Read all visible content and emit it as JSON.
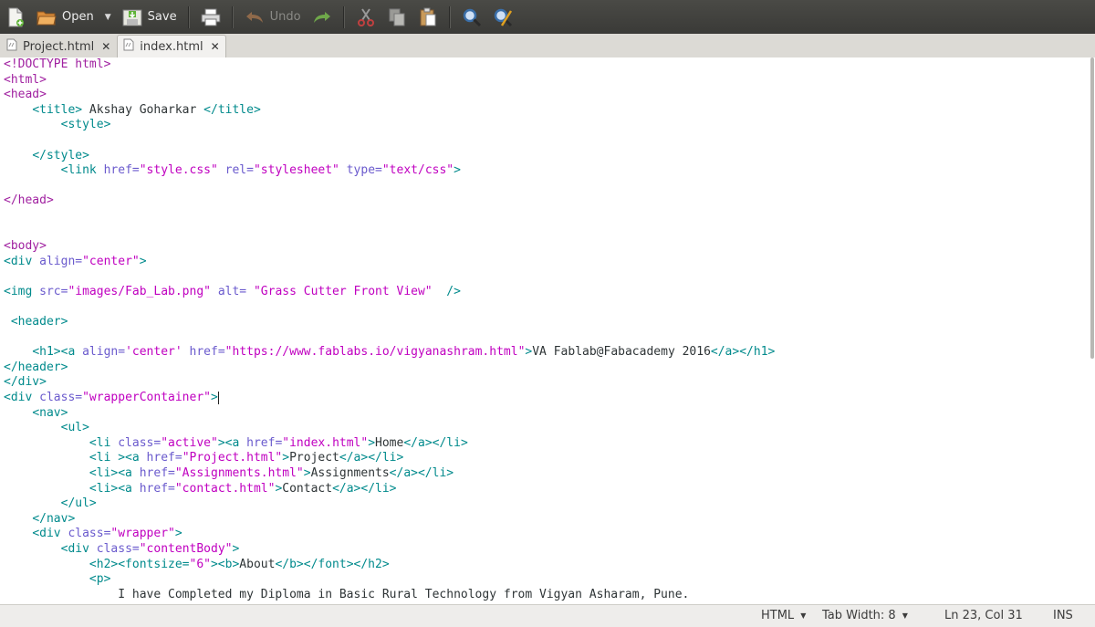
{
  "toolbar": {
    "buttons": [
      {
        "icon": "new-document-icon",
        "label": ""
      },
      {
        "icon": "open-folder-icon",
        "label": "Open"
      },
      {
        "icon": "save-icon",
        "label": "Save"
      },
      {
        "icon": "print-icon",
        "label": ""
      },
      {
        "icon": "undo-icon",
        "label": "Undo"
      },
      {
        "icon": "redo-icon",
        "label": ""
      },
      {
        "icon": "cut-icon",
        "label": ""
      },
      {
        "icon": "copy-icon",
        "label": ""
      },
      {
        "icon": "paste-icon",
        "label": ""
      },
      {
        "icon": "search-icon",
        "label": ""
      },
      {
        "icon": "replace-icon",
        "label": ""
      }
    ],
    "open_label": "Open",
    "save_label": "Save",
    "undo_label": "Undo"
  },
  "tabs": [
    {
      "label": "Project.html",
      "active": false
    },
    {
      "label": "index.html",
      "active": true
    }
  ],
  "editor": {
    "lines": [
      [
        [
          "tag",
          "<!DOCTYPE html>"
        ]
      ],
      [
        [
          "tag",
          "<html>"
        ]
      ],
      [
        [
          "tag",
          "<head>"
        ]
      ],
      [
        [
          "text",
          "    "
        ],
        [
          "tagname",
          "<title>"
        ],
        [
          "text",
          " Akshay Goharkar "
        ],
        [
          "tagname",
          "</title>"
        ]
      ],
      [
        [
          "text",
          "        "
        ],
        [
          "tagname",
          "<style>"
        ]
      ],
      [],
      [
        [
          "text",
          "    "
        ],
        [
          "tagname",
          "</style>"
        ]
      ],
      [
        [
          "text",
          "        "
        ],
        [
          "tagname",
          "<link "
        ],
        [
          "attr",
          "href="
        ],
        [
          "str",
          "\"style.css\""
        ],
        [
          "attr",
          " rel="
        ],
        [
          "str",
          "\"stylesheet\""
        ],
        [
          "attr",
          " type="
        ],
        [
          "str",
          "\"text/css\""
        ],
        [
          "tagname",
          ">"
        ]
      ],
      [],
      [
        [
          "tag",
          "</head>"
        ]
      ],
      [],
      [],
      [
        [
          "tag",
          "<body>"
        ]
      ],
      [
        [
          "tagname",
          "<div "
        ],
        [
          "attr",
          "align="
        ],
        [
          "str",
          "\"center\""
        ],
        [
          "tagname",
          ">"
        ]
      ],
      [],
      [
        [
          "tagname",
          "<img "
        ],
        [
          "attr",
          "src="
        ],
        [
          "str",
          "\"images/Fab_Lab.png\""
        ],
        [
          "attr",
          " alt= "
        ],
        [
          "str",
          "\"Grass Cutter Front View\""
        ],
        [
          "text",
          "  "
        ],
        [
          "tagname",
          "/>"
        ]
      ],
      [],
      [
        [
          "text",
          " "
        ],
        [
          "tagname",
          "<header>"
        ]
      ],
      [],
      [
        [
          "text",
          "    "
        ],
        [
          "tagname",
          "<h1><a "
        ],
        [
          "attr",
          "align="
        ],
        [
          "str",
          "'center'"
        ],
        [
          "attr",
          " href="
        ],
        [
          "str",
          "\"https://www.fablabs.io/vigyanashram.html\""
        ],
        [
          "tagname",
          ">"
        ],
        [
          "text",
          "VA Fablab@Fabacademy 2016"
        ],
        [
          "tagname",
          "</a></h1>"
        ]
      ],
      [
        [
          "tagname",
          "</header>"
        ]
      ],
      [
        [
          "tagname",
          "</div>"
        ]
      ],
      [
        [
          "tagname",
          "<div "
        ],
        [
          "attr",
          "class="
        ],
        [
          "str",
          "\"wrapperContainer\""
        ],
        [
          "tagname",
          ">"
        ],
        [
          "caret",
          ""
        ]
      ],
      [
        [
          "text",
          "    "
        ],
        [
          "tagname",
          "<nav>"
        ]
      ],
      [
        [
          "text",
          "        "
        ],
        [
          "tagname",
          "<ul>"
        ]
      ],
      [
        [
          "text",
          "            "
        ],
        [
          "tagname",
          "<li "
        ],
        [
          "attr",
          "class="
        ],
        [
          "str",
          "\"active\""
        ],
        [
          "tagname",
          "><a "
        ],
        [
          "attr",
          "href="
        ],
        [
          "str",
          "\"index.html\""
        ],
        [
          "tagname",
          ">"
        ],
        [
          "text",
          "Home"
        ],
        [
          "tagname",
          "</a></li>"
        ]
      ],
      [
        [
          "text",
          "            "
        ],
        [
          "tagname",
          "<li ><a "
        ],
        [
          "attr",
          "href="
        ],
        [
          "str",
          "\"Project.html\""
        ],
        [
          "tagname",
          ">"
        ],
        [
          "text",
          "Project"
        ],
        [
          "tagname",
          "</a></li>"
        ]
      ],
      [
        [
          "text",
          "            "
        ],
        [
          "tagname",
          "<li><a "
        ],
        [
          "attr",
          "href="
        ],
        [
          "str",
          "\"Assignments.html\""
        ],
        [
          "tagname",
          ">"
        ],
        [
          "text",
          "Assignments"
        ],
        [
          "tagname",
          "</a></li>"
        ]
      ],
      [
        [
          "text",
          "            "
        ],
        [
          "tagname",
          "<li><a "
        ],
        [
          "attr",
          "href="
        ],
        [
          "str",
          "\"contact.html\""
        ],
        [
          "tagname",
          ">"
        ],
        [
          "text",
          "Contact"
        ],
        [
          "tagname",
          "</a></li>"
        ]
      ],
      [
        [
          "text",
          "        "
        ],
        [
          "tagname",
          "</ul>"
        ]
      ],
      [
        [
          "text",
          "    "
        ],
        [
          "tagname",
          "</nav>"
        ]
      ],
      [
        [
          "text",
          "    "
        ],
        [
          "tagname",
          "<div "
        ],
        [
          "attr",
          "class="
        ],
        [
          "str",
          "\"wrapper\""
        ],
        [
          "tagname",
          ">"
        ]
      ],
      [
        [
          "text",
          "        "
        ],
        [
          "tagname",
          "<div "
        ],
        [
          "attr",
          "class="
        ],
        [
          "str",
          "\"contentBody\""
        ],
        [
          "tagname",
          ">"
        ]
      ],
      [
        [
          "text",
          "            "
        ],
        [
          "tagname",
          "<h2><fontsize="
        ],
        [
          "str",
          "\"6\""
        ],
        [
          "tagname",
          "><b>"
        ],
        [
          "text",
          "About"
        ],
        [
          "tagname",
          "</b></font></h2>"
        ]
      ],
      [
        [
          "text",
          "            "
        ],
        [
          "tagname",
          "<p>"
        ]
      ],
      [
        [
          "text",
          "                I have Completed my Diploma in Basic Rural Technology from Vigyan Asharam, Pune."
        ]
      ]
    ]
  },
  "statusbar": {
    "language": "HTML",
    "tab_width": "Tab Width: 8",
    "position": "Ln 23, Col 31",
    "mode": "INS"
  },
  "colors": {
    "toolbar_bg": "#3f3f3c",
    "tag": "#a020a0",
    "tagname": "#008a8c",
    "attribute": "#6a5acd",
    "string": "#c000c0"
  }
}
